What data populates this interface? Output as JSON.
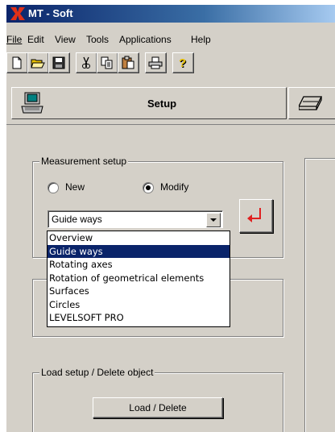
{
  "window": {
    "title": "MT - Soft",
    "accent_color": "#0a246a",
    "logo_color": "#e03018"
  },
  "menu": {
    "items": [
      {
        "label": "File",
        "icon": ""
      },
      {
        "label": "Edit"
      },
      {
        "label": "View"
      },
      {
        "label": "Tools"
      },
      {
        "label": "Applications"
      },
      {
        "label": "Help"
      }
    ]
  },
  "toolbar": {
    "buttons": [
      "new-file-icon",
      "open-folder-icon",
      "save-disk-icon",
      "cut-scissors-icon",
      "copy-icon",
      "paste-icon",
      "print-icon",
      "help-question-icon"
    ]
  },
  "tabs": {
    "setup_label": "Setup",
    "setup_icon": "computer-icon",
    "second_icon": "surface-plate-icon"
  },
  "measurement_setup": {
    "caption": "Measurement setup",
    "radio_new": "New",
    "radio_modify": "Modify",
    "selected_radio": "Modify",
    "combo_value": "Guide ways",
    "apply_icon": "enter-arrow-icon",
    "dropdown_options": [
      "Overview",
      "Guide ways",
      "Rotating axes",
      "Rotation of geometrical elements",
      "Surfaces",
      "Circles",
      "LEVELSOFT PRO"
    ],
    "dropdown_selected": "Guide ways"
  },
  "load_setup": {
    "caption": "Load setup / Delete object",
    "button_label": "Load / Delete"
  }
}
